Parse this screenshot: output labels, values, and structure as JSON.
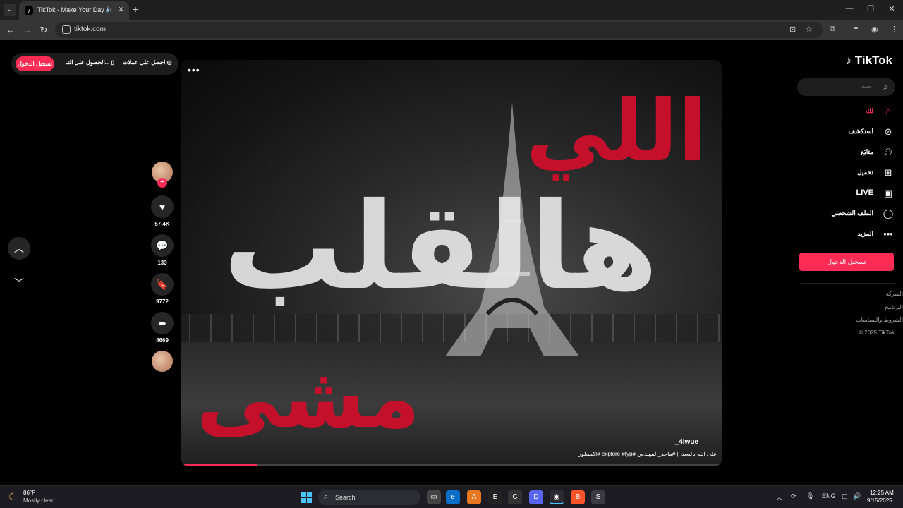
{
  "browser": {
    "tab_title": "TikTok - Make Your Day",
    "url": "tiktok.com",
    "new_tab_symbol": "+"
  },
  "promo": {
    "login_label": "تسجيل الدخول",
    "item1_label": "الحصول على التـ...",
    "item2_label": "احصل على عملات"
  },
  "video": {
    "word_top": "اللي",
    "word_middle": "هالقلب",
    "word_bottom": "مشى",
    "author": "_4iwue",
    "caption": "على الله يالبعيد || #ماجد_المهندس #explore #fyp #اكسبلور",
    "more_label": "•••",
    "progress": 0.14
  },
  "actions": {
    "likes": "57.4K",
    "comments": "133",
    "saves": "9772",
    "shares": "4669"
  },
  "sidebar": {
    "logo": "TikTok",
    "search_placeholder": "بحث",
    "items": [
      {
        "label": "لك"
      },
      {
        "label": "استكشف"
      },
      {
        "label": "متابَع"
      },
      {
        "label": "تحميل"
      },
      {
        "label": "LIVE"
      },
      {
        "label": "الملف الشخصي"
      },
      {
        "label": "المزيد"
      }
    ],
    "login_button": "تسجيل الدخول",
    "footer": [
      "الشركة",
      "البرنامج",
      "الشروط والسياسات",
      "© 2025 TikTok"
    ]
  },
  "taskbar": {
    "temperature": "86°F",
    "weather": "Mostly clear",
    "search_label": "Search",
    "language": "ENG",
    "time": "12:25 AM",
    "date": "9/15/2025"
  },
  "colors": {
    "accent": "#fe2c55",
    "overlay_red": "#c4102a"
  }
}
